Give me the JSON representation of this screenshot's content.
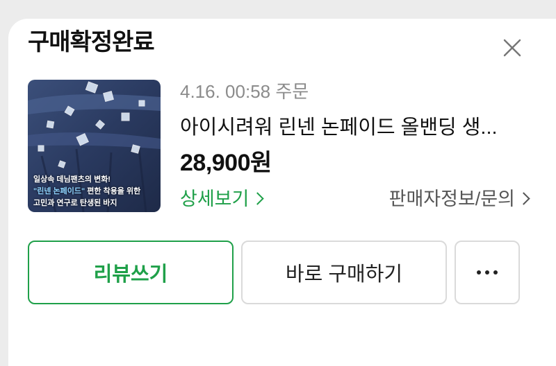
{
  "card": {
    "title": "구매확정완료",
    "close_icon": "close-icon"
  },
  "order": {
    "date": "4.16. 00:58 주문",
    "product_name": "아이시려워 린넨 논페이드 올밴딩 생...",
    "price": "28,900원",
    "thumbnail": {
      "line1": "일상속 데님팬츠의 변화!",
      "highlight": "\"린넨 논페이드\"",
      "line2_rest": " 편한 착용을 위한",
      "line3": "고민과 연구로 탄생된 바지"
    }
  },
  "links": {
    "detail": "상세보기",
    "seller": "판매자정보/문의"
  },
  "buttons": {
    "review": "리뷰쓰기",
    "rebuy": "바로 구매하기",
    "more_icon": "more-dots-icon"
  },
  "colors": {
    "accent": "#1fa049",
    "title": "#111111",
    "muted": "#8b8b8b",
    "border": "#dadada"
  }
}
